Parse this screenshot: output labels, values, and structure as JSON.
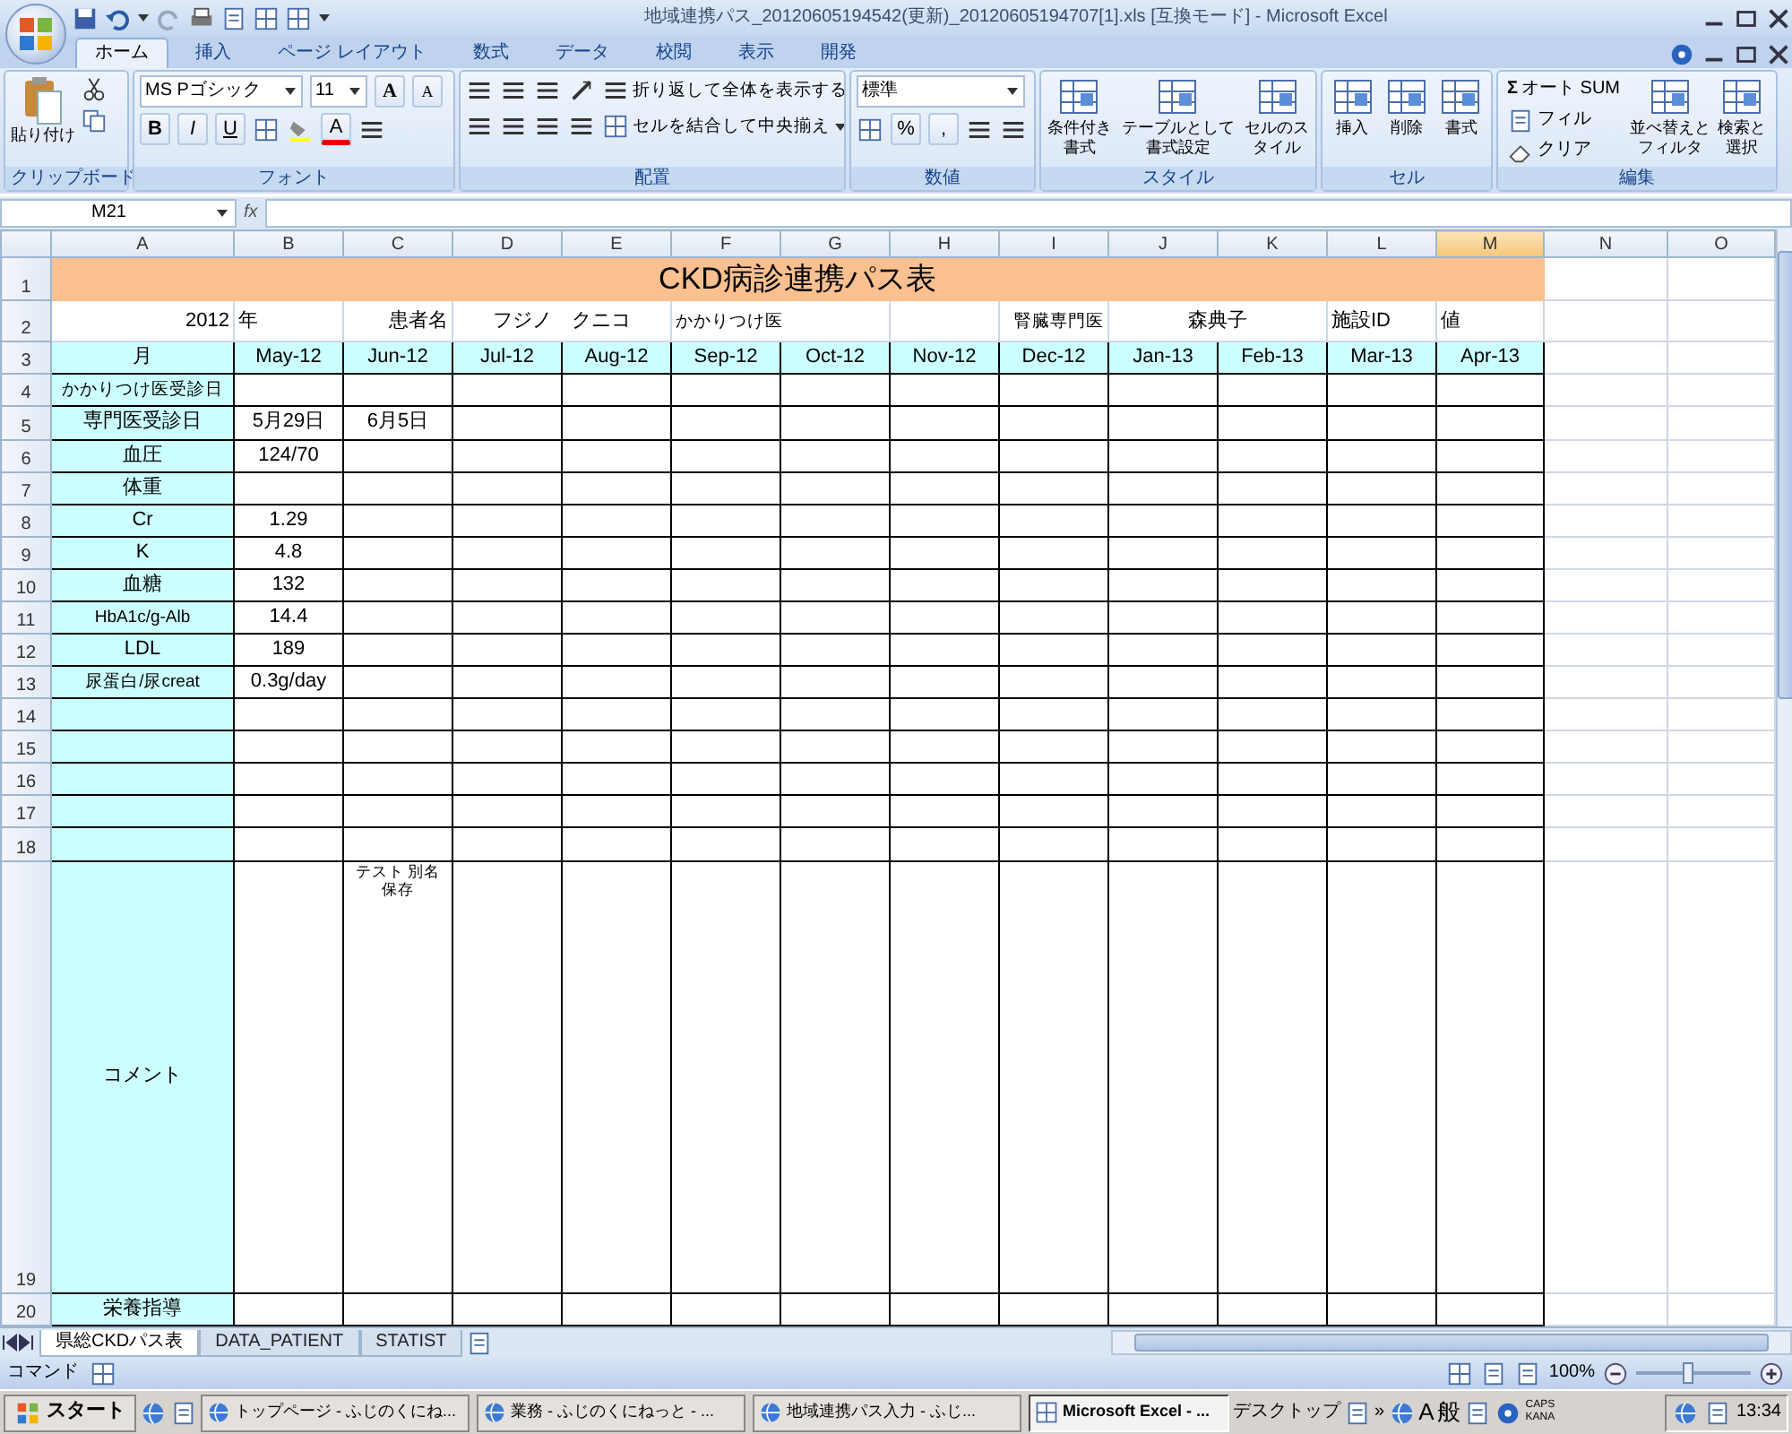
{
  "window": {
    "title": "地域連携パス_20120605194542(更新)_20120605194707[1].xls  [互換モード] - Microsoft Excel"
  },
  "tabs": [
    {
      "label": "ホーム",
      "selected": true
    },
    {
      "label": "挿入",
      "selected": false
    },
    {
      "label": "ページ レイアウト",
      "selected": false
    },
    {
      "label": "数式",
      "selected": false
    },
    {
      "label": "データ",
      "selected": false
    },
    {
      "label": "校閲",
      "selected": false
    },
    {
      "label": "表示",
      "selected": false
    },
    {
      "label": "開発",
      "selected": false
    }
  ],
  "ribbon": {
    "clipboard": {
      "paste": "貼り付け",
      "label": "クリップボード"
    },
    "font": {
      "name": "MS Pゴシック",
      "size": "11",
      "grow": "A",
      "shrink": "A",
      "bold": "B",
      "italic": "I",
      "underline": "U",
      "font_color_button": "A",
      "label": "フォント"
    },
    "alignment": {
      "wrap": "折り返して全体を表示する",
      "merge": "セルを結合して中央揃え",
      "label": "配置"
    },
    "number": {
      "format": "標準",
      "percent": "%",
      "comma": ",",
      "label": "数値"
    },
    "styles": {
      "conditional": "条件付き書式",
      "table": "テーブルとして書式設定",
      "cell_styles": "セルのスタイル",
      "label": "スタイル"
    },
    "cells": {
      "insert": "挿入",
      "delete": "削除",
      "format": "書式",
      "label": "セル"
    },
    "editing": {
      "sigma": "Σ",
      "autosum": "オート SUM",
      "fill": "フィル",
      "clear": "クリア",
      "sort": "並べ替えとフィルタ",
      "find": "検索と選択",
      "label": "編集"
    }
  },
  "formula_bar": {
    "name_box": "M21",
    "fx": "fx"
  },
  "sheet": {
    "columns": [
      {
        "letter": "A",
        "selected": false
      },
      {
        "letter": "B",
        "selected": false
      },
      {
        "letter": "C",
        "selected": false
      },
      {
        "letter": "D",
        "selected": false
      },
      {
        "letter": "E",
        "selected": false
      },
      {
        "letter": "F",
        "selected": false
      },
      {
        "letter": "G",
        "selected": false
      },
      {
        "letter": "H",
        "selected": false
      },
      {
        "letter": "I",
        "selected": false
      },
      {
        "letter": "J",
        "selected": false
      },
      {
        "letter": "K",
        "selected": false
      },
      {
        "letter": "L",
        "selected": false
      },
      {
        "letter": "M",
        "selected": true
      },
      {
        "letter": "N",
        "selected": false
      },
      {
        "letter": "O",
        "selected": false
      }
    ],
    "rows": [
      {
        "number": "1",
        "kind": "title",
        "cells": {
          "A": "CKD病診連携パス表"
        }
      },
      {
        "number": "2",
        "kind": "info",
        "cells": {
          "A": "2012",
          "B": "年",
          "C": "患者名",
          "D": "フジノ　クニコ",
          "F": "かかりつけ医",
          "I": "腎臓専門医",
          "J": "森典子",
          "L": "施設ID",
          "M": "値"
        }
      },
      {
        "number": "3",
        "kind": "months",
        "cells": {
          "A": "月",
          "B": "May-12",
          "C": "Jun-12",
          "D": "Jul-12",
          "E": "Aug-12",
          "F": "Sep-12",
          "G": "Oct-12",
          "H": "Nov-12",
          "I": "Dec-12",
          "J": "Jan-13",
          "K": "Feb-13",
          "L": "Mar-13",
          "M": "Apr-13"
        }
      },
      {
        "number": "4",
        "kind": "data",
        "cells": {
          "A": "かかりつけ医受診日"
        }
      },
      {
        "number": "5",
        "kind": "data",
        "cells": {
          "A": "専門医受診日",
          "B": "5月29日",
          "C": "6月5日"
        }
      },
      {
        "number": "6",
        "kind": "data",
        "cells": {
          "A": "血圧",
          "B": "124/70"
        }
      },
      {
        "number": "7",
        "kind": "data",
        "cells": {
          "A": "体重"
        }
      },
      {
        "number": "8",
        "kind": "data",
        "cells": {
          "A": "Cr",
          "B": "1.29"
        }
      },
      {
        "number": "9",
        "kind": "data",
        "cells": {
          "A": "K",
          "B": "4.8"
        }
      },
      {
        "number": "10",
        "kind": "data",
        "cells": {
          "A": "血糖",
          "B": "132"
        }
      },
      {
        "number": "11",
        "kind": "data",
        "cells": {
          "A": "HbA1c/g-Alb",
          "B": "14.4"
        }
      },
      {
        "number": "12",
        "kind": "data",
        "cells": {
          "A": "LDL",
          "B": "189"
        }
      },
      {
        "number": "13",
        "kind": "data",
        "cells": {
          "A": "尿蛋白/尿creat",
          "B": "0.3g/day"
        }
      },
      {
        "number": "14",
        "kind": "data"
      },
      {
        "number": "15",
        "kind": "data"
      },
      {
        "number": "16",
        "kind": "data"
      },
      {
        "number": "17",
        "kind": "data"
      },
      {
        "number": "18",
        "kind": "data"
      },
      {
        "number": "19",
        "kind": "comment",
        "cells": {
          "A": "コメント",
          "C": "テスト 別名保存"
        }
      },
      {
        "number": "20",
        "kind": "data",
        "cells": {
          "A": "栄養指導"
        }
      }
    ]
  },
  "sheet_tabs": [
    {
      "label": "県総CKDパス表",
      "selected": true
    },
    {
      "label": "DATA_PATIENT",
      "selected": false
    },
    {
      "label": "STATIST",
      "selected": false
    }
  ],
  "status_bar": {
    "mode": "コマンド",
    "zoom": "100%",
    "zoom_slider": {
      "level": 0.45
    }
  },
  "taskbar": {
    "start": "スタート",
    "windows": [
      {
        "label": "トップページ - ふじのくにね...",
        "selected": false
      },
      {
        "label": "業務 - ふじのくにねっと - ...",
        "selected": false
      },
      {
        "label": "地域連携パス入力 - ふじ...",
        "selected": false
      },
      {
        "label": "Microsoft Excel - ...",
        "selected": true
      }
    ],
    "desktop": "デスクトップ",
    "more": "»",
    "ime_mode": "A",
    "ime_kanji": "般",
    "caps": "CAPS",
    "kana": "KANA",
    "clock": "13:34"
  }
}
